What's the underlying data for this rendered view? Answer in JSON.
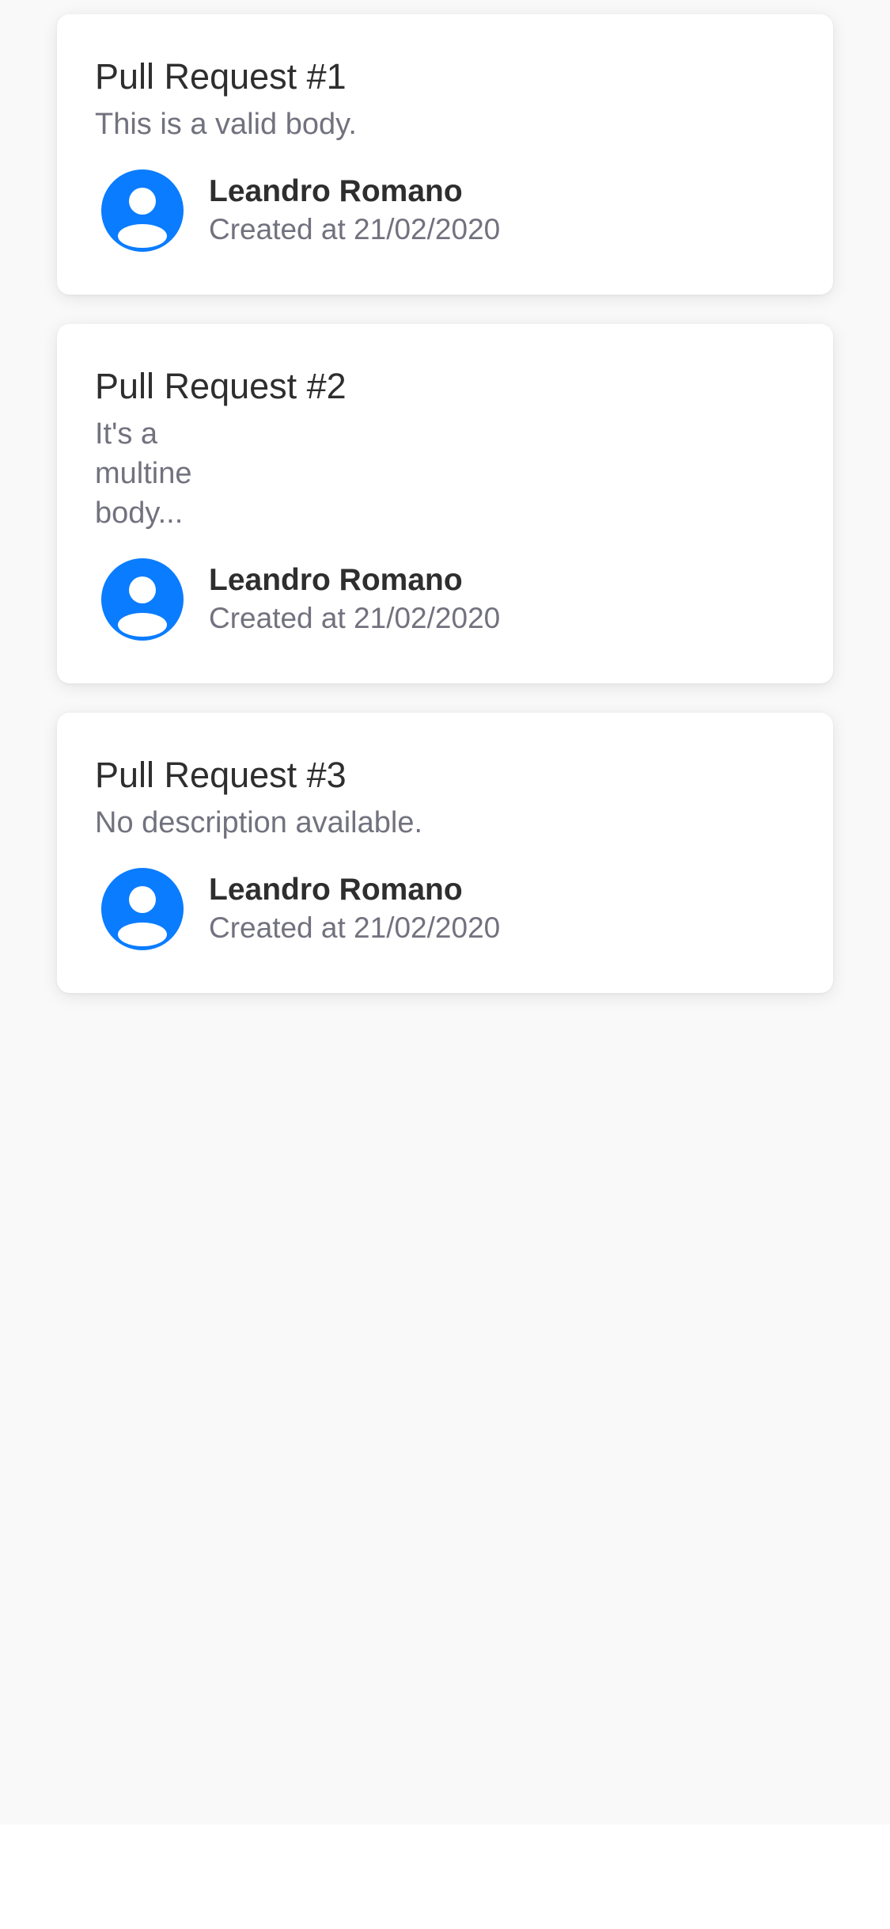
{
  "pull_requests": [
    {
      "title": "Pull Request #1",
      "body": "This is a valid body.",
      "author": "Leandro Romano",
      "created": "Created at 21/02/2020",
      "avatar_icon": "user-avatar-icon"
    },
    {
      "title": "Pull Request #2",
      "body": "It's a\nmultine\nbody...",
      "author": "Leandro Romano",
      "created": "Created at 21/02/2020",
      "avatar_icon": "user-avatar-icon"
    },
    {
      "title": "Pull Request #3",
      "body": "No description available.",
      "author": "Leandro Romano",
      "created": "Created at 21/02/2020",
      "avatar_icon": "user-avatar-icon"
    }
  ],
  "colors": {
    "accent": "#0a7cff",
    "title": "#2e2e2e",
    "secondary": "#72727f",
    "background": "#f9f9f9"
  }
}
